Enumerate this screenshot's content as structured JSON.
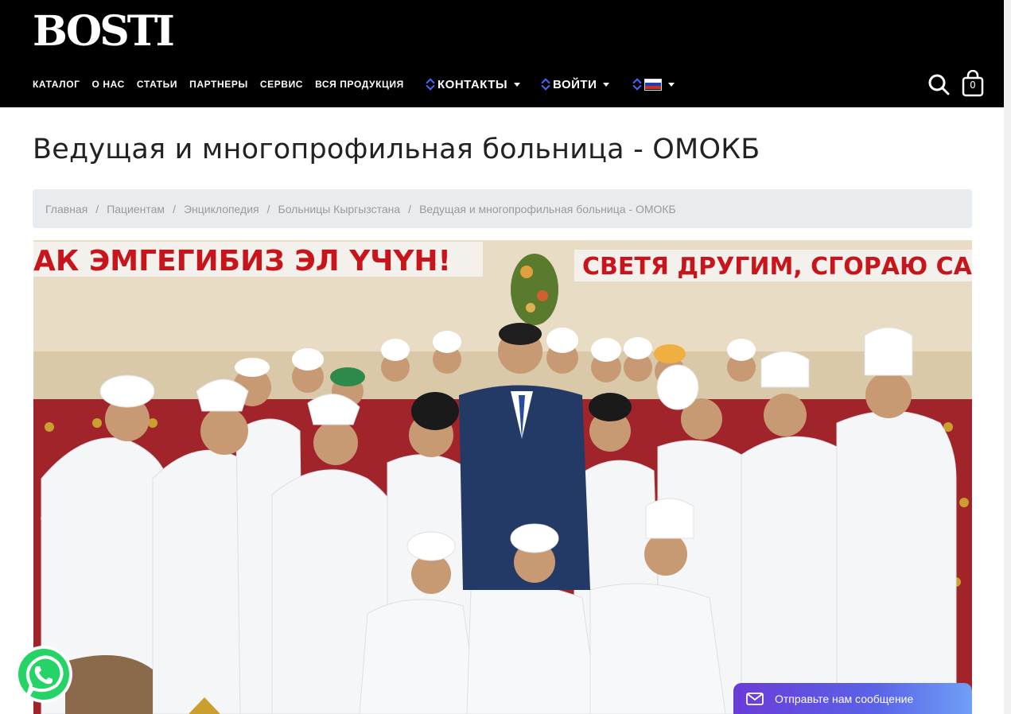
{
  "header": {
    "logo": "BOSTI",
    "nav": [
      "КАТАЛОГ",
      "О НАС",
      "СТАТЬИ",
      "ПАРТНЕРЫ",
      "СЕРВИС",
      "ВСЯ ПРОДУКЦИЯ"
    ],
    "contacts_label": "КОНТАКТЫ",
    "login_label": "ВОЙТИ",
    "language_icon": "russian-flag-icon",
    "search_icon": "search-icon",
    "cart_icon": "shopping-bag-icon",
    "cart_count": "0"
  },
  "page": {
    "title": "Ведущая и многопрофильная больница - ОМОКБ"
  },
  "breadcrumb": [
    "Главная",
    "Пациентам",
    "Энциклопедия",
    "Больницы Кыргызстана",
    "Ведущая и многопрофильная больница - ОМОКБ"
  ],
  "photo": {
    "banner_left": "АК ЭМГЕГИБИЗ ЭЛ ҮЧҮН!",
    "banner_right": "СВЕТЯ ДРУГИМ, СГОРАЮ СА"
  },
  "chat": {
    "label": "Отправьте нам сообщение"
  },
  "colors": {
    "header_bg": "#000000",
    "accent_icon": "#4a66ff",
    "breadcrumb_bg": "#e9ecef",
    "whatsapp": "#25d366",
    "chat_gradient_start": "#6a3bd8",
    "chat_gradient_end": "#6fa0f5"
  }
}
